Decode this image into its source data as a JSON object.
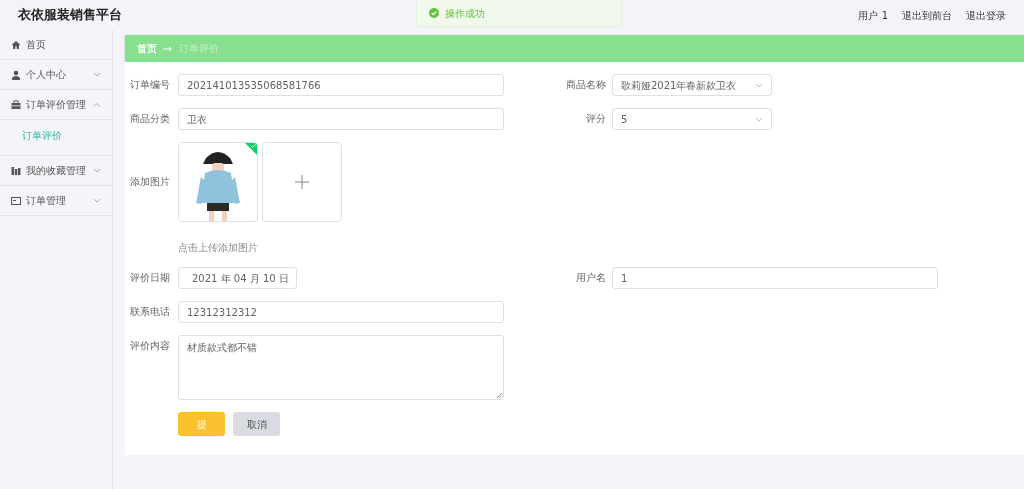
{
  "header": {
    "title": "衣依服装销售平台",
    "links": [
      "用户 1",
      "退出到前台",
      "退出登录"
    ]
  },
  "toast": {
    "message": "操作成功"
  },
  "sidebar": {
    "items": [
      {
        "label": "首页",
        "kind": "home"
      },
      {
        "label": "个人中心",
        "kind": "user",
        "expanded": false
      },
      {
        "label": "订单评价管理",
        "kind": "bag",
        "expanded": true,
        "children": [
          {
            "label": "订单评价",
            "selected": true
          }
        ]
      },
      {
        "label": "我的收藏管理",
        "kind": "chart",
        "expanded": false
      },
      {
        "label": "订单管理",
        "kind": "card",
        "expanded": false
      }
    ]
  },
  "breadcrumb": [
    "首页",
    "订单评价"
  ],
  "form": {
    "rows": [
      {
        "fields": [
          {
            "kind": "text",
            "label": "订单编号",
            "value": "202141013535068581766"
          },
          {
            "kind": "select",
            "label": "商品名称",
            "value": "歌莉娅2021年春新款卫衣"
          }
        ]
      },
      {
        "fields": [
          {
            "kind": "text",
            "label": "商品分类",
            "value": "卫衣"
          },
          {
            "kind": "select",
            "label": "评分",
            "value": "5"
          }
        ]
      },
      {
        "fields": [
          {
            "kind": "upload",
            "label": "添加图片",
            "hint": "点击上传添加图片"
          }
        ]
      },
      {
        "fields": [
          {
            "kind": "date",
            "label": "评价日期",
            "value": "2021 年 04 月 10 日"
          },
          {
            "kind": "wide",
            "label": "用户名",
            "value": "1"
          }
        ]
      },
      {
        "fields": [
          {
            "kind": "text",
            "label": "联系电话",
            "value": "12312312312"
          }
        ]
      },
      {
        "fields": [
          {
            "kind": "textarea",
            "label": "评价内容",
            "value": "材质款式都不错"
          }
        ]
      }
    ],
    "buttons": [
      {
        "label": "提",
        "kind": "primary"
      },
      {
        "label": "取消",
        "kind": "secondary"
      }
    ]
  }
}
